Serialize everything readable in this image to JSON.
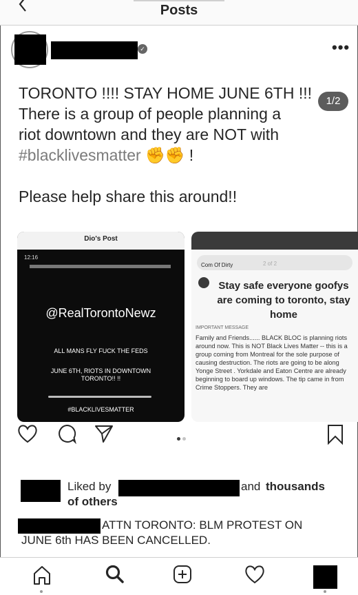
{
  "header": {
    "title": "Posts"
  },
  "caption": {
    "line1": "TORONTO !!!! STAY HOME JUNE 6TH !!!",
    "line2": "There is a group of people planning a",
    "line3": "riot downtown and they are NOT with",
    "hashtag": "#blacklivesmatter",
    "exclaim": "!",
    "share": "Please help share this around!!",
    "page_indicator": "1/2"
  },
  "image_left": {
    "title": "Dio's Post",
    "status": "12:16",
    "handle": "@RealTorontoNewz",
    "line1": "ALL MANS FLY FUCK THE FEDS",
    "line2": "JUNE 6TH, RIOTS IN DOWNTOWN TORONTO!! !!",
    "line3": "#BLACKLIVESMATTER"
  },
  "image_right": {
    "pill_text": "Com Of Dirty",
    "pill_num": "2 of 2",
    "heading": "Stay safe everyone goofys are coming to toronto, stay home",
    "label": "IMPORTANT MESSAGE",
    "body": "Family and Friends...... BLACK BLOC is planning riots around now. This is NOT Black Lives Matter -- this is a group coming from Montreal for the sole purpose of causing destruction. The riots are going to be along Yonge Street . Yorkdale and Eaton Centre are already beginning to board up windows. The tip came in from Crime Stoppers. They are"
  },
  "likes": {
    "liked_by": "Liked by",
    "and": "and",
    "thousands": "thousands",
    "of_others": "of others"
  },
  "comment": {
    "text1": "ATTN TORONTO: BLM PROTEST ON",
    "text2": "JUNE 6th HAS BEEN CANCELLED."
  },
  "icons": {
    "back": "chevron-left-icon",
    "more": "more-icon",
    "like": "heart-icon",
    "comment": "comment-icon",
    "share": "send-icon",
    "save": "bookmark-icon",
    "home": "home-icon",
    "search": "search-icon",
    "add": "add-icon",
    "activity": "heart-icon"
  },
  "more_glyph": "•••"
}
